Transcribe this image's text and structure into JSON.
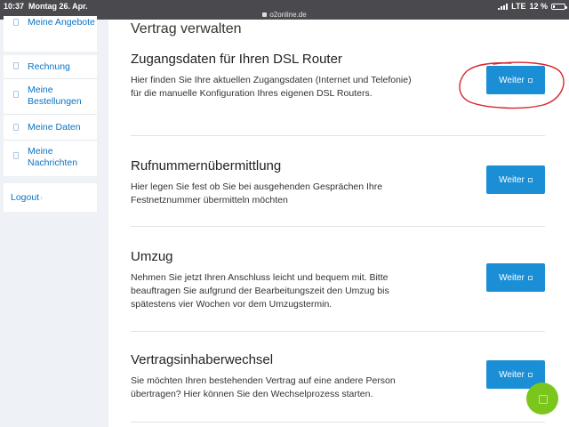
{
  "status_bar": {
    "time": "10:37",
    "date": "Montag 26. Apr.",
    "url": "o2online.de",
    "carrier": "LTE",
    "battery": "12 %"
  },
  "sidebar": {
    "items": [
      {
        "label": "Meine Angebote",
        "icon": "document-icon"
      },
      {
        "label": "Rechnung",
        "icon": "document-icon"
      },
      {
        "label": "Meine Bestellungen",
        "icon": "document-icon"
      },
      {
        "label": "Meine Daten",
        "icon": "document-icon"
      },
      {
        "label": "Meine Nachrichten",
        "icon": "document-icon"
      }
    ],
    "logout_label": "Logout"
  },
  "main": {
    "title": "Vertrag verwalten",
    "sections": [
      {
        "heading": "Zugangsdaten für Ihren DSL Router",
        "text": "Hier finden Sie Ihre aktuellen Zugangsdaten (Internet und Telefonie) für die manuelle Konfiguration Ihres eigenen DSL Routers.",
        "button": "Weiter"
      },
      {
        "heading": "Rufnummernübermittlung",
        "text": "Hier legen Sie fest ob Sie bei ausgehenden Gesprächen Ihre Festnetznummer übermitteln möchten",
        "button": "Weiter"
      },
      {
        "heading": "Umzug",
        "text": "Nehmen Sie jetzt Ihren Anschluss leicht und bequem mit. Bitte beauftragen Sie aufgrund der Bearbeitungszeit den Umzug bis spätestens vier Wochen vor dem Umzugstermin.",
        "button": "Weiter"
      },
      {
        "heading": "Vertragsinhaberwechsel",
        "text": "Sie möchten Ihren bestehenden Vertrag auf eine andere Person übertragen? Hier können Sie den Wechselprozess starten.",
        "button": "Weiter"
      }
    ]
  },
  "colors": {
    "accent": "#1b8fd6",
    "link": "#0a73c4",
    "sidebar_bg": "#eef2f6",
    "annotation": "#d8262e",
    "fab": "#7bc61c"
  }
}
